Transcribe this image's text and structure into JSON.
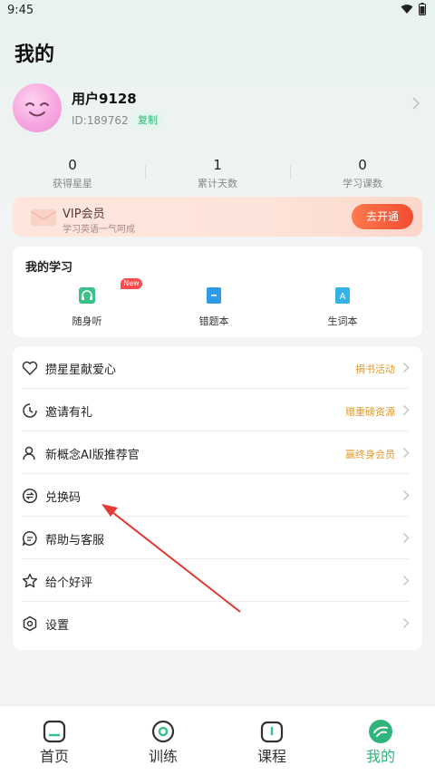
{
  "status_bar": {
    "time": "9:45"
  },
  "page": {
    "title": "我的"
  },
  "profile": {
    "username": "用户9128",
    "id_text": "ID:189762",
    "copy_label": "复制"
  },
  "stats": [
    {
      "value": "0",
      "label": "获得星星"
    },
    {
      "value": "1",
      "label": "累计天数"
    },
    {
      "value": "0",
      "label": "学习课数"
    }
  ],
  "vip": {
    "title": "VIP会员",
    "subtitle": "学习英语一气呵成",
    "button": "去开通"
  },
  "study": {
    "title": "我的学习",
    "new_badge": "New",
    "items": [
      {
        "label": "随身听",
        "icon": "headphones-icon"
      },
      {
        "label": "错题本",
        "icon": "notebook-icon"
      },
      {
        "label": "生词本",
        "icon": "vocabulary-icon"
      }
    ]
  },
  "menu": [
    {
      "label": "攒星星献爱心",
      "tag": "捐书活动",
      "icon": "heart-icon"
    },
    {
      "label": "邀请有礼",
      "tag": "赠重磅资源",
      "icon": "gift-icon"
    },
    {
      "label": "新概念AI版推荐官",
      "tag": "赢终身会员",
      "icon": "person-icon"
    },
    {
      "label": "兑换码",
      "tag": "",
      "icon": "exchange-icon"
    },
    {
      "label": "帮助与客服",
      "tag": "",
      "icon": "message-icon"
    },
    {
      "label": "给个好评",
      "tag": "",
      "icon": "star-icon"
    },
    {
      "label": "设置",
      "tag": "",
      "icon": "settings-icon"
    }
  ],
  "tabs": [
    {
      "label": "首页",
      "icon": "home-icon",
      "active": false
    },
    {
      "label": "训练",
      "icon": "target-icon",
      "active": false
    },
    {
      "label": "课程",
      "icon": "course-icon",
      "active": false
    },
    {
      "label": "我的",
      "icon": "me-icon",
      "active": true
    }
  ],
  "colors": {
    "accent_green": "#2fb47c",
    "tag_orange": "#e39a2c",
    "vip_button": "#f24b32",
    "annotation_red": "#e53935"
  }
}
